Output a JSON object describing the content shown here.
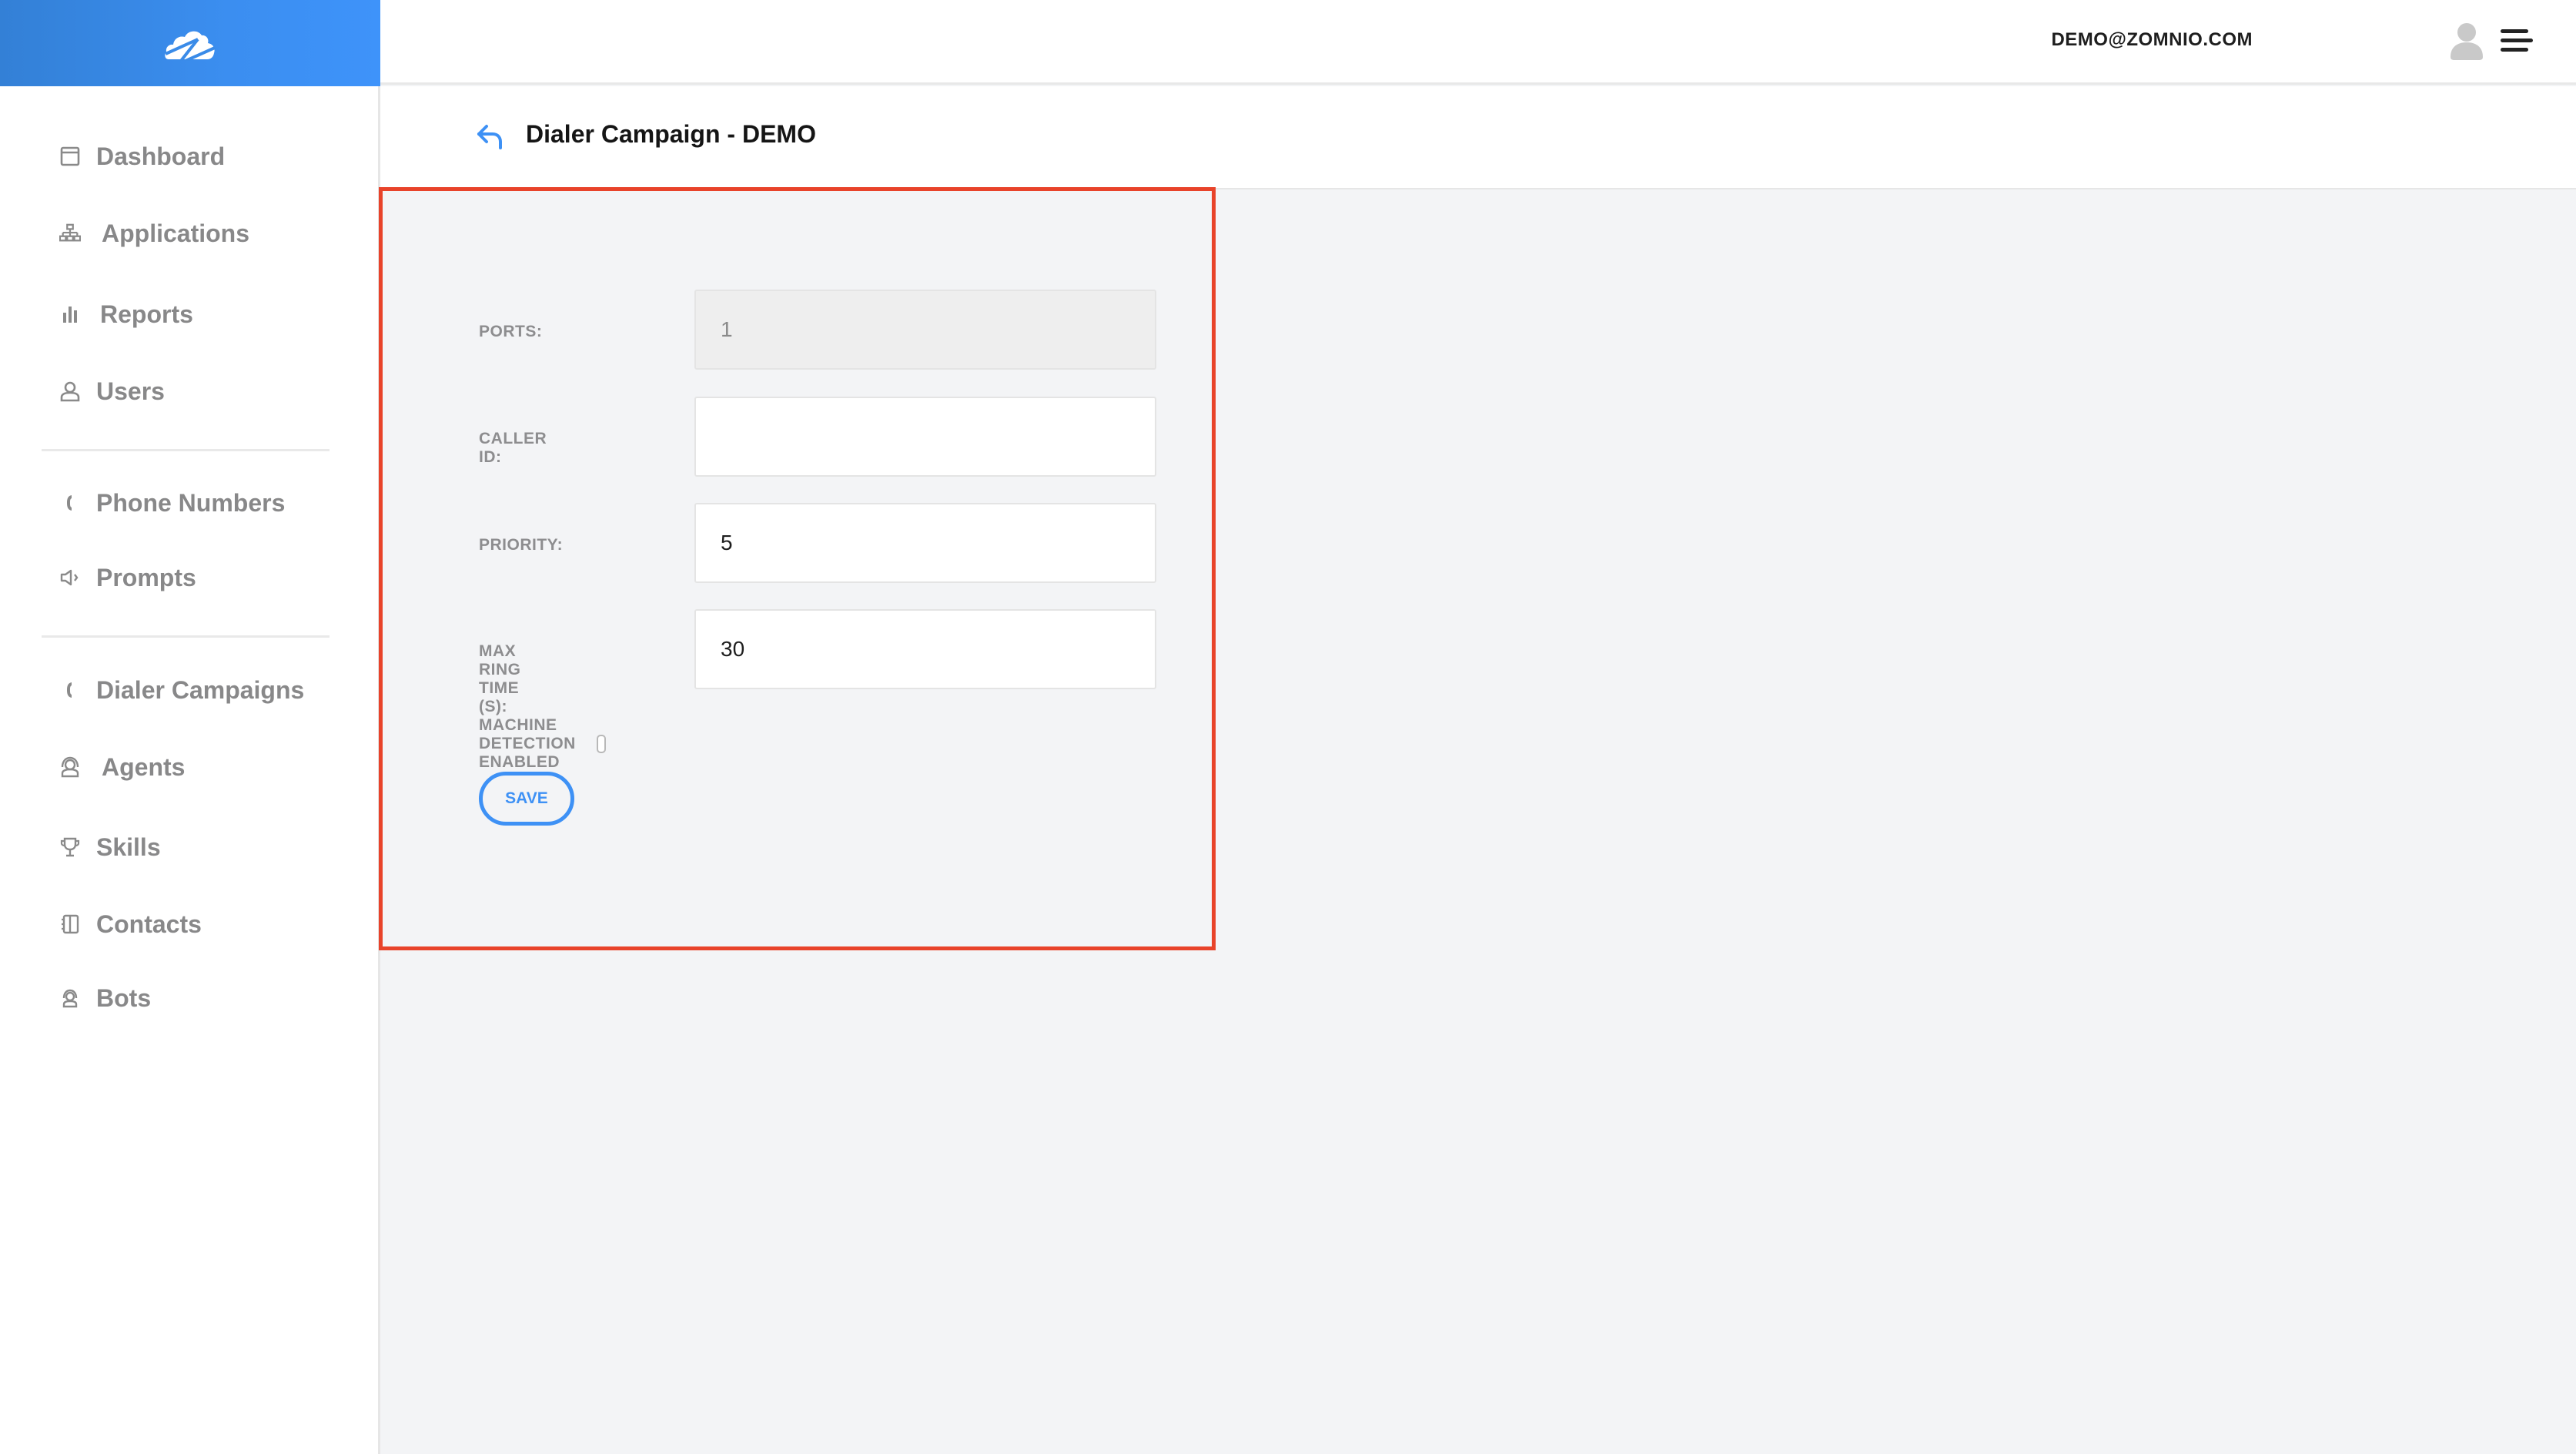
{
  "header": {
    "logo": "zomnio-cloud-logo",
    "user_email": "DEMO@ZOMNIO.COM",
    "avatar_icon": "user-avatar-icon",
    "menu_icon": "hamburger-menu-icon"
  },
  "sidebar": {
    "items": [
      {
        "label": "Dashboard",
        "icon": "dashboard-icon"
      },
      {
        "label": "Applications",
        "icon": "sitemap-icon"
      },
      {
        "label": "Reports",
        "icon": "bar-chart-icon"
      },
      {
        "label": "Users",
        "icon": "user-icon"
      },
      {
        "label": "Phone Numbers",
        "icon": "phone-icon"
      },
      {
        "label": "Prompts",
        "icon": "speaker-icon"
      },
      {
        "label": "Dialer Campaigns",
        "icon": "phone-icon"
      },
      {
        "label": "Agents",
        "icon": "headset-icon"
      },
      {
        "label": "Skills",
        "icon": "trophy-icon"
      },
      {
        "label": "Contacts",
        "icon": "address-book-icon"
      },
      {
        "label": "Bots",
        "icon": "bot-icon"
      }
    ]
  },
  "page": {
    "title": "Dialer Campaign - DEMO",
    "back_icon": "back-arrow-icon"
  },
  "form": {
    "ports": {
      "label": "PORTS:",
      "value": "1",
      "disabled": true
    },
    "caller_id": {
      "label": "CALLER ID:",
      "value": ""
    },
    "priority": {
      "label": "PRIORITY:",
      "value": "5"
    },
    "max_ring_time": {
      "label": "MAX RING TIME (S):",
      "value": "30"
    },
    "machine_detection": {
      "label": "MACHINE DETECTION ENABLED",
      "checked": false
    },
    "save_label": "SAVE"
  },
  "colors": {
    "brand_blue": "#3e91f5",
    "highlight_red": "#e8432a",
    "nav_text": "#888889"
  }
}
